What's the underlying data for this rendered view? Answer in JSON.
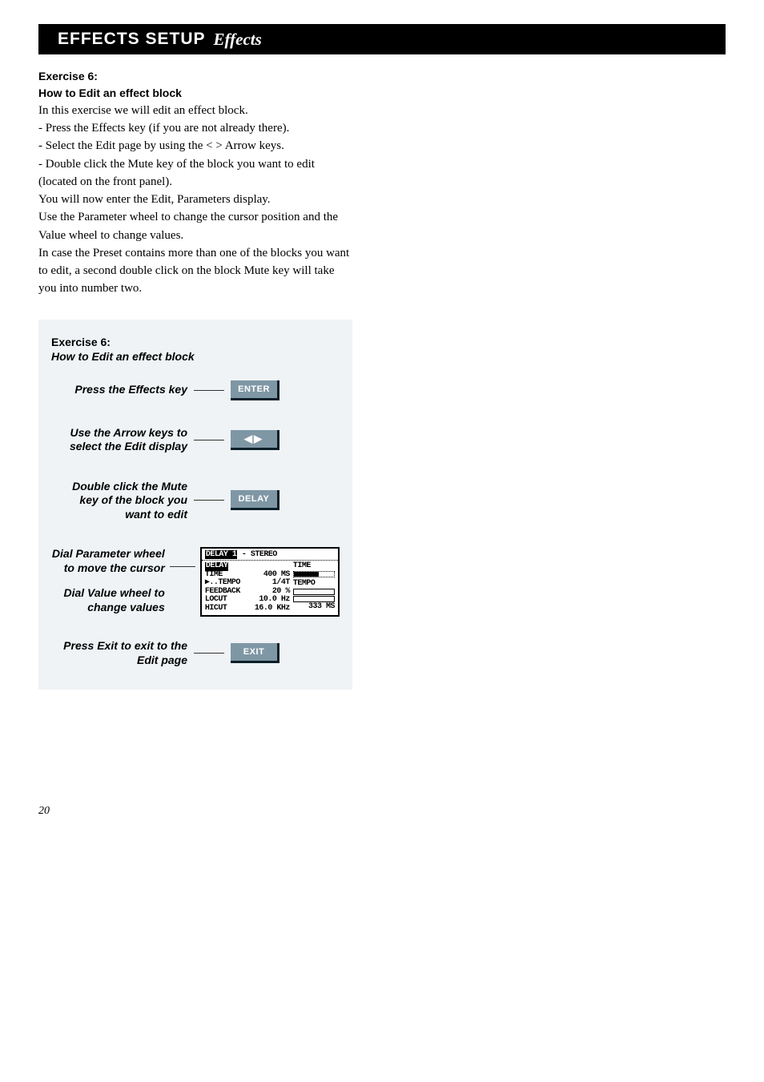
{
  "header": {
    "title_bold": "EFFECTS SETUP",
    "title_ital": "Effects"
  },
  "exercise": {
    "heading": "Exercise 6:",
    "subheading": "How to Edit an effect block",
    "intro": "In this exercise we will edit an effect block.",
    "lines": [
      "- Press the Effects key (if you are not already there).",
      "- Select the Edit page by using the < > Arrow keys.",
      "- Double click the Mute key of the block you want to edit",
      "(located   on the front panel).",
      "You will now enter the Edit, Parameters display.",
      "Use the Parameter wheel to change the cursor position and the",
      "Value wheel to change values.",
      "In case the Preset contains more than one of the blocks you want",
      "to edit, a second double click on the block Mute key will take",
      "you into number two."
    ]
  },
  "shadebox": {
    "heading": "Exercise 6:",
    "subheading": "How to Edit an effect block",
    "steps": [
      {
        "label": "Press the Effects key",
        "button": "ENTER"
      },
      {
        "label": "Use the Arrow keys to select the Edit display",
        "button": "ARROWS"
      },
      {
        "label": "Double click the Mute key of the block you want to edit",
        "button": "DELAY"
      }
    ],
    "screen_label_a": "Dial Parameter wheel to move the cursor",
    "screen_label_b": "Dial Value wheel to change values",
    "exit_label": "Press Exit to exit to the Edit page",
    "exit_button": "EXIT",
    "lcd": {
      "title_inv": "DELAY 1",
      "title_rest": " - STEREO",
      "rows": [
        {
          "k": "DELAY",
          "v": "",
          "inv": true
        },
        {
          "k": "TIME",
          "v": "400 MS"
        },
        {
          "k": "▶..TEMPO",
          "v": "1/4T"
        },
        {
          "k": "FEEDBACK",
          "v": "20 %"
        },
        {
          "k": "LOCUT",
          "v": "10.0 Hz"
        },
        {
          "k": "HICUT",
          "v": "16.0 KHz"
        }
      ],
      "right": {
        "time_label": "TIME",
        "tempo_label": "TEMPO",
        "readout": "333 MS"
      }
    }
  },
  "page_number": "20"
}
